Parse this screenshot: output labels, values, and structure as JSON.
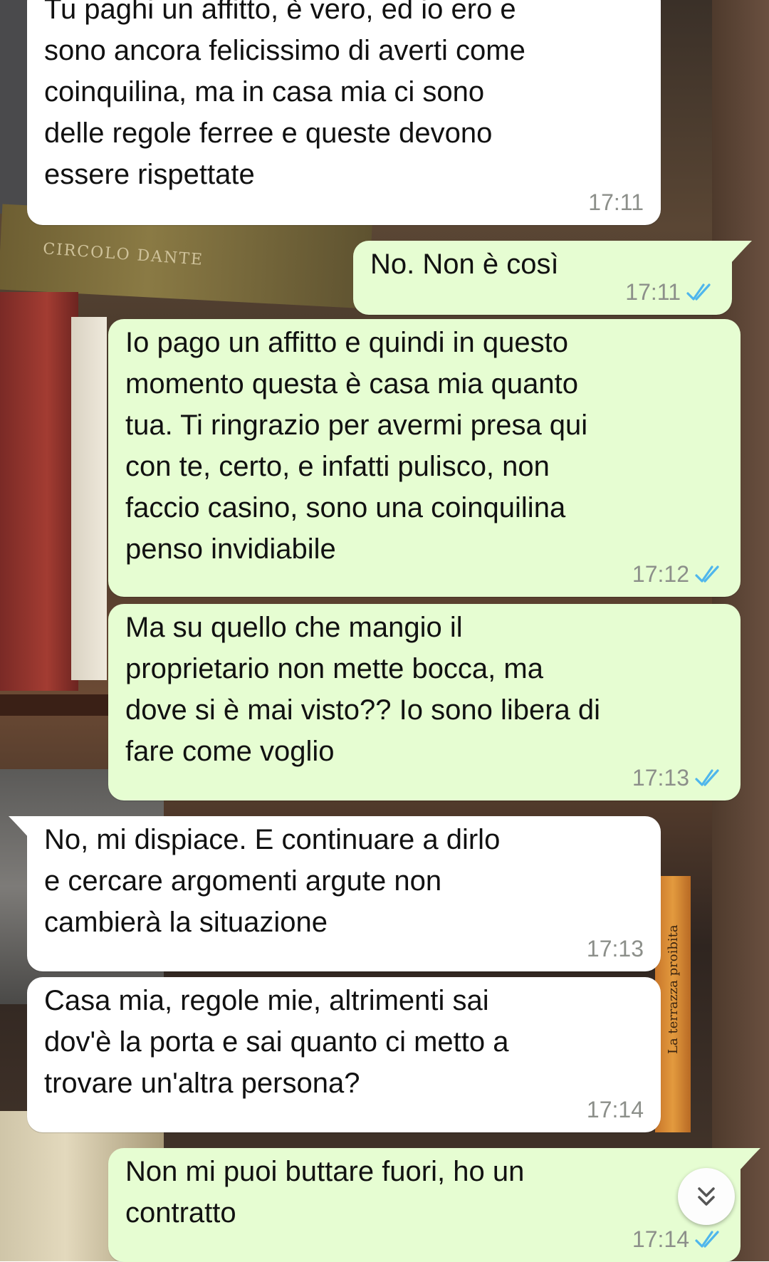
{
  "background": {
    "book_title": "CIRCOLO DANTE",
    "spine_title": "La terrazza proibita"
  },
  "colors": {
    "incoming_bubble": "#ffffff",
    "outgoing_bubble": "#e6fdd2",
    "timestamp": "#8c8f8a",
    "read_ticks": "#4fb6ec"
  },
  "messages": [
    {
      "direction": "incoming",
      "text": "Tu paghi un affitto, è vero, ed io ero e\nsono ancora felicissimo di averti come\ncoinquilina, ma in casa mia ci sono\ndelle regole ferree e queste devono\nessere rispettate",
      "time": "17:11"
    },
    {
      "direction": "outgoing",
      "text": "No. Non è così",
      "time": "17:11",
      "status": "read"
    },
    {
      "direction": "outgoing",
      "text": "Io pago un affitto e quindi in questo\nmomento questa è casa mia quanto\ntua. Ti ringrazio per avermi presa qui\ncon te, certo, e infatti pulisco, non\nfaccio casino, sono una coinquilina\npenso invidiabile",
      "time": "17:12",
      "status": "read"
    },
    {
      "direction": "outgoing",
      "text": "Ma su quello che mangio il\nproprietario non mette bocca, ma\ndove si è mai visto?? Io sono libera di\nfare come voglio",
      "time": "17:13",
      "status": "read"
    },
    {
      "direction": "incoming",
      "text": "No, mi dispiace. E continuare a dirlo\ne cercare argomenti argute non\ncambierà la situazione",
      "time": "17:13"
    },
    {
      "direction": "incoming",
      "text": "Casa mia, regole mie, altrimenti sai\ndov'è la porta e sai quanto ci metto a\ntrovare un'altra persona?",
      "time": "17:14"
    },
    {
      "direction": "outgoing",
      "text": "Non mi puoi buttare fuori, ho un\ncontratto",
      "time": "17:14",
      "status": "read"
    }
  ],
  "scroll_button": {
    "icon": "double-chevron-down-icon"
  }
}
